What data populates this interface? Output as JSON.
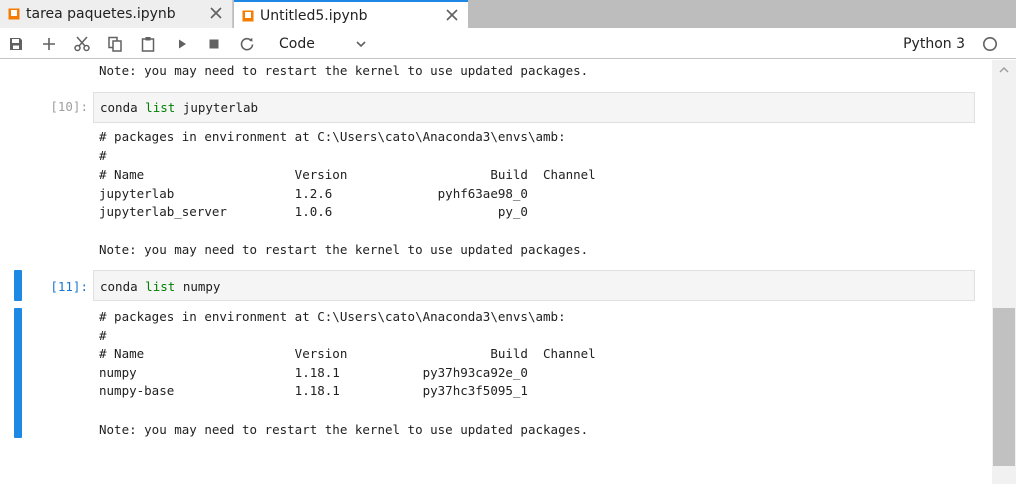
{
  "tabs": [
    {
      "label": "tarea paquetes.ipynb",
      "active": false
    },
    {
      "label": "Untitled5.ipynb",
      "active": true
    }
  ],
  "toolbar": {
    "icons": [
      "save-icon",
      "add-cell-icon",
      "cut-icon",
      "copy-icon",
      "paste-icon",
      "run-icon",
      "stop-icon",
      "restart-icon"
    ],
    "cell_type": "Code",
    "kernel": "Python 3"
  },
  "colors": {
    "accent": "#1e88e5",
    "keyword": "#008000",
    "tab_icon": "#f57c00"
  },
  "notebook": {
    "top_output_line": "Note: you may need to restart the kernel to use updated packages.",
    "cells": [
      {
        "prompt": "[10]:",
        "code_cmd": "conda",
        "code_kw": "list",
        "code_arg": "jupyterlab",
        "output": [
          "# packages in environment at C:\\Users\\cato\\Anaconda3\\envs\\amb:",
          "#",
          "# Name                    Version                   Build  Channel",
          "jupyterlab                1.2.6              pyhf63ae98_0",
          "jupyterlab_server         1.0.6                      py_0",
          "",
          "Note: you may need to restart the kernel to use updated packages."
        ]
      },
      {
        "prompt": "[11]:",
        "code_cmd": "conda",
        "code_kw": "list",
        "code_arg": "numpy",
        "output": [
          "# packages in environment at C:\\Users\\cato\\Anaconda3\\envs\\amb:",
          "#",
          "# Name                    Version                   Build  Channel",
          "numpy                     1.18.1           py37h93ca92e_0",
          "numpy-base                1.18.1           py37hc3f5095_1",
          "",
          "Note: you may need to restart the kernel to use updated packages."
        ]
      }
    ]
  }
}
